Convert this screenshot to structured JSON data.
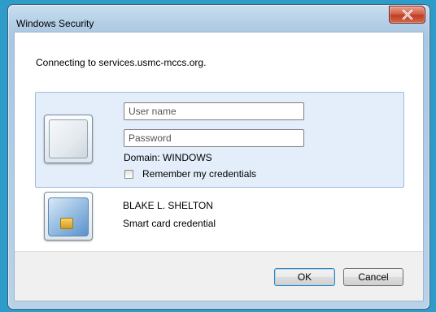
{
  "window": {
    "title": "Windows Security",
    "close_label": "x"
  },
  "message": "Connecting to services.usmc-mccs.org.",
  "credential": {
    "username_placeholder": "User name",
    "password_placeholder": "Password",
    "username_value": "",
    "password_value": "",
    "domain_text": "Domain: WINDOWS",
    "remember_label": "Remember my credentials",
    "remember_checked": false
  },
  "smartcard": {
    "name": "BLAKE L.  SHELTON",
    "description": "Smart card credential"
  },
  "buttons": {
    "ok_label": "OK",
    "cancel_label": "Cancel"
  },
  "colors": {
    "desktop_background": "#2e9cc9",
    "selected_tile_background": "#e3eefa",
    "close_button": "#c13d22"
  }
}
